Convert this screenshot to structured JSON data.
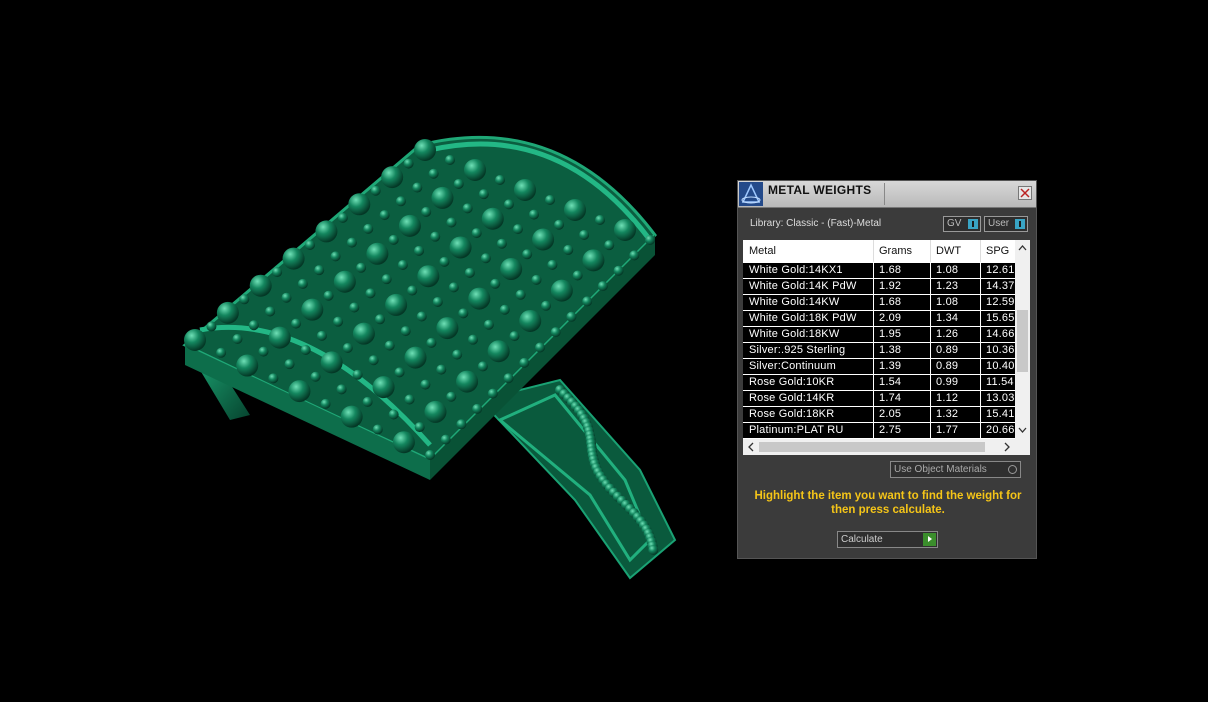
{
  "colors": {
    "ring": "#12805c",
    "panel": "#3b3b3b",
    "hint": "#f5c518",
    "accent": "#39a4c4"
  },
  "panel": {
    "title": "METAL WEIGHTS",
    "library_label": "Library: Classic - (Fast)-Metal",
    "toggle_gv": "GV",
    "toggle_user": "User",
    "columns": [
      "Metal",
      "Grams",
      "DWT",
      "SPG"
    ],
    "rows": [
      {
        "metal": "White Gold:14KX1",
        "grams": "1.68",
        "dwt": "1.08",
        "spg": "12.61"
      },
      {
        "metal": "White Gold:14K PdW",
        "grams": "1.92",
        "dwt": "1.23",
        "spg": "14.37"
      },
      {
        "metal": "White Gold:14KW",
        "grams": "1.68",
        "dwt": "1.08",
        "spg": "12.59"
      },
      {
        "metal": "White Gold:18K PdW",
        "grams": "2.09",
        "dwt": "1.34",
        "spg": "15.65"
      },
      {
        "metal": "White Gold:18KW",
        "grams": "1.95",
        "dwt": "1.26",
        "spg": "14.66"
      },
      {
        "metal": "Silver:.925 Sterling",
        "grams": "1.38",
        "dwt": "0.89",
        "spg": "10.36"
      },
      {
        "metal": "Silver:Continuum",
        "grams": "1.39",
        "dwt": "0.89",
        "spg": "10.40"
      },
      {
        "metal": "Rose Gold:10KR",
        "grams": "1.54",
        "dwt": "0.99",
        "spg": "11.54"
      },
      {
        "metal": "Rose Gold:14KR",
        "grams": "1.74",
        "dwt": "1.12",
        "spg": "13.03"
      },
      {
        "metal": "Rose Gold:18KR",
        "grams": "2.05",
        "dwt": "1.32",
        "spg": "15.41"
      },
      {
        "metal": "Platinum:PLAT RU",
        "grams": "2.75",
        "dwt": "1.77",
        "spg": "20.66"
      }
    ],
    "use_object_materials": "Use Object Materials",
    "hint": "Highlight the item you want to find the weight for then press calculate.",
    "calculate": "Calculate"
  },
  "icons": [
    "app-logo-icon",
    "close-icon",
    "scroll-up-icon",
    "scroll-down-icon",
    "scroll-left-icon",
    "scroll-right-icon",
    "play-icon"
  ]
}
